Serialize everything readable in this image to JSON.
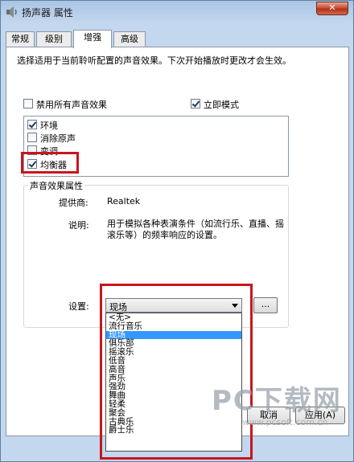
{
  "window": {
    "title": "扬声器 属性",
    "close_label": "✕"
  },
  "tabs": [
    "常规",
    "级别",
    "增强",
    "高级"
  ],
  "description": "选择适用于当前聆听配置的声音效果。下次开始播放时更改才会生效。",
  "disable_all": {
    "label": "禁用所有声音效果",
    "checked": false
  },
  "immediate_mode": {
    "label": "立即模式",
    "checked": true
  },
  "effects": [
    {
      "label": "环境",
      "checked": true
    },
    {
      "label": "消除原声",
      "checked": false
    },
    {
      "label": "变调",
      "checked": false
    },
    {
      "label": "均衡器",
      "checked": true
    }
  ],
  "properties": {
    "group_title": "声音效果属性",
    "provider_label": "提供商:",
    "provider_value": "Realtek",
    "desc_label": "说明:",
    "desc_value": "用于模拟各种表演条件（如流行乐、直播、摇滚乐等）的频率响应的设置。",
    "setting_label": "设置:",
    "setting_value": "现场",
    "browse_label": "..."
  },
  "dropdown_options": [
    "<无>",
    "流行音乐",
    "现场",
    "俱乐部",
    "摇滚乐",
    "低音",
    "高音",
    "声乐",
    "强劲",
    "舞曲",
    "轻柔",
    "聚会",
    "古典乐",
    "爵士乐"
  ],
  "selected_option": "现场",
  "buttons": {
    "cancel": "取消",
    "apply": "应用(A)"
  },
  "watermark": {
    "brand": "PC下载网",
    "url": "www.pcsoft.com.cn"
  }
}
